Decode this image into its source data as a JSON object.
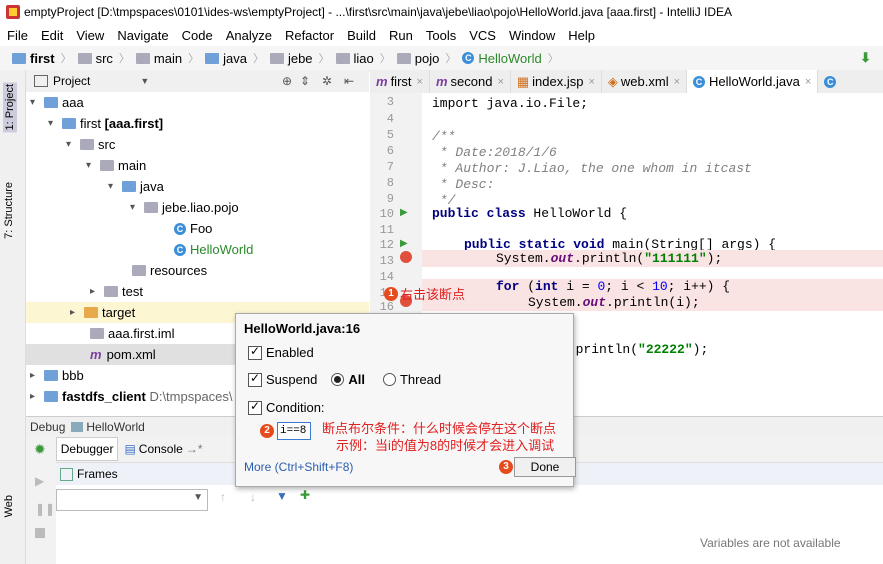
{
  "window": {
    "title": "emptyProject [D:\\tmpspaces\\0101\\ides-ws\\emptyProject] - ...\\first\\src\\main\\java\\jebe\\liao\\pojo\\HelloWorld.java [aaa.first] - IntelliJ IDEA"
  },
  "menu": [
    "File",
    "Edit",
    "View",
    "Navigate",
    "Code",
    "Analyze",
    "Refactor",
    "Build",
    "Run",
    "Tools",
    "VCS",
    "Window",
    "Help"
  ],
  "breadcrumb": [
    "first",
    "src",
    "main",
    "java",
    "jebe",
    "liao",
    "pojo",
    "HelloWorld"
  ],
  "left_strip": {
    "project": "1: Project",
    "structure": "7: Structure",
    "web": "Web"
  },
  "project_panel": {
    "title": "Project"
  },
  "tree": [
    {
      "label": "aaa"
    },
    {
      "label": "first",
      "extra": "[aaa.first]"
    },
    {
      "label": "src"
    },
    {
      "label": "main"
    },
    {
      "label": "java"
    },
    {
      "label": "jebe.liao.pojo"
    },
    {
      "label": "Foo"
    },
    {
      "label": "HelloWorld"
    },
    {
      "label": "resources"
    },
    {
      "label": "test"
    },
    {
      "label": "target"
    },
    {
      "label": "aaa.first.iml"
    },
    {
      "label": "pom.xml"
    },
    {
      "label": "bbb"
    },
    {
      "label": "fastdfs_client",
      "extra": "D:\\tmpspaces\\"
    }
  ],
  "editor_tabs": [
    {
      "label": "first"
    },
    {
      "label": "second"
    },
    {
      "label": "index.jsp"
    },
    {
      "label": "web.xml"
    },
    {
      "label": "HelloWorld.java",
      "active": true
    }
  ],
  "code": {
    "line_numbers": [
      "3",
      "4",
      "5",
      "6",
      "7",
      "8",
      "9",
      "10",
      "11",
      "12",
      "13",
      "14",
      "15",
      "16"
    ],
    "import": "import java.io.File;",
    "c1": "/**",
    "c2": " * Date:2018/1/6",
    "c3": " * Author: J.Liao, the one whom in itcast",
    "c4": " * Desc:",
    "c5": " */",
    "class_kw": "public class",
    "class_name": " HelloWorld {",
    "main_kw": "public static void",
    "main_rest": " main(String[] args) {",
    "p1_pre": "System.",
    "p1_out": "out",
    "p1_mid": ".println(",
    "p1_str": "\"111111\"",
    "p1_end": ");",
    "for_kw": "for",
    "for_open": " (",
    "for_int": "int",
    "for_rest": " i = ",
    "for_zero": "0",
    "for_mid": "; i < ",
    "for_ten": "10",
    "for_end": "; i++) {",
    "p2_pre": "System.",
    "p2_out": "out",
    "p2_end": ".println(i);",
    "p3_out": "t",
    "p3_mid": ".println(",
    "p3_str": "\"22222\"",
    "p3_end": ");"
  },
  "annotations": {
    "a1_num": "1",
    "a1_text": "右击该断点",
    "a2_num": "2",
    "a2_line1": "断点布尔条件：什么时候会停在这个断点",
    "a2_line2": "示例：当i的值为8的时候才会进入调试",
    "a3_num": "3"
  },
  "popup": {
    "title": "HelloWorld.java:16",
    "enabled": "Enabled",
    "suspend": "Suspend",
    "all": "All",
    "thread": "Thread",
    "condition": "Condition:",
    "condition_value": "i==8",
    "more": "More (Ctrl+Shift+F8)",
    "done": "Done"
  },
  "debug": {
    "label": "Debug",
    "config": "HelloWorld",
    "debugger_tab": "Debugger",
    "console_tab": "Console",
    "frames": "Frames",
    "variables_empty": "Variables are not available"
  }
}
